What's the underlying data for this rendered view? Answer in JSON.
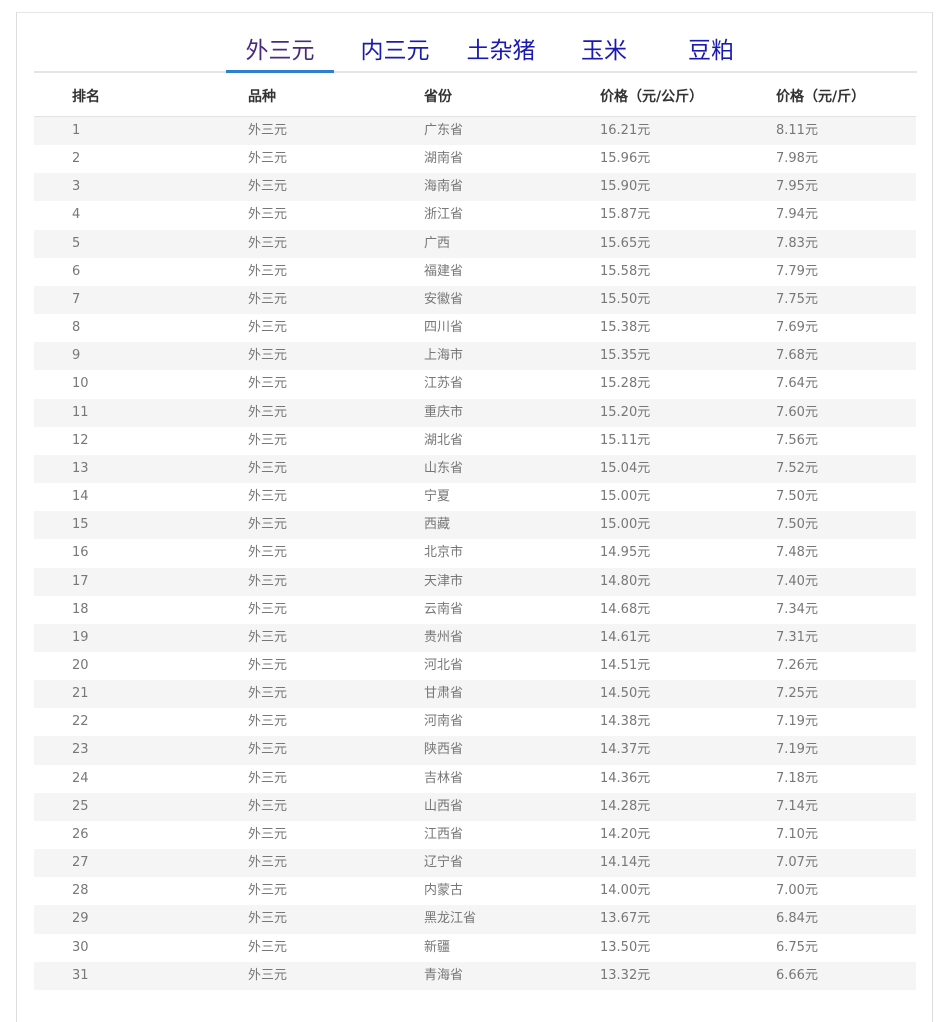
{
  "tabs": [
    {
      "label": "外三元",
      "active": true
    },
    {
      "label": "内三元",
      "active": false
    },
    {
      "label": "土杂猪",
      "active": false
    },
    {
      "label": "玉米",
      "active": false
    },
    {
      "label": "豆粕",
      "active": false
    }
  ],
  "table": {
    "headers": {
      "rank": "排名",
      "breed": "品种",
      "province": "省份",
      "price_kg": "价格（元/公斤）",
      "price_jin": "价格（元/斤）"
    },
    "rows": [
      {
        "rank": "1",
        "breed": "外三元",
        "province": "广东省",
        "price_kg": "16.21元",
        "price_jin": "8.11元"
      },
      {
        "rank": "2",
        "breed": "外三元",
        "province": "湖南省",
        "price_kg": "15.96元",
        "price_jin": "7.98元"
      },
      {
        "rank": "3",
        "breed": "外三元",
        "province": "海南省",
        "price_kg": "15.90元",
        "price_jin": "7.95元"
      },
      {
        "rank": "4",
        "breed": "外三元",
        "province": "浙江省",
        "price_kg": "15.87元",
        "price_jin": "7.94元"
      },
      {
        "rank": "5",
        "breed": "外三元",
        "province": "广西",
        "price_kg": "15.65元",
        "price_jin": "7.83元"
      },
      {
        "rank": "6",
        "breed": "外三元",
        "province": "福建省",
        "price_kg": "15.58元",
        "price_jin": "7.79元"
      },
      {
        "rank": "7",
        "breed": "外三元",
        "province": "安徽省",
        "price_kg": "15.50元",
        "price_jin": "7.75元"
      },
      {
        "rank": "8",
        "breed": "外三元",
        "province": "四川省",
        "price_kg": "15.38元",
        "price_jin": "7.69元"
      },
      {
        "rank": "9",
        "breed": "外三元",
        "province": "上海市",
        "price_kg": "15.35元",
        "price_jin": "7.68元"
      },
      {
        "rank": "10",
        "breed": "外三元",
        "province": "江苏省",
        "price_kg": "15.28元",
        "price_jin": "7.64元"
      },
      {
        "rank": "11",
        "breed": "外三元",
        "province": "重庆市",
        "price_kg": "15.20元",
        "price_jin": "7.60元"
      },
      {
        "rank": "12",
        "breed": "外三元",
        "province": "湖北省",
        "price_kg": "15.11元",
        "price_jin": "7.56元"
      },
      {
        "rank": "13",
        "breed": "外三元",
        "province": "山东省",
        "price_kg": "15.04元",
        "price_jin": "7.52元"
      },
      {
        "rank": "14",
        "breed": "外三元",
        "province": "宁夏",
        "price_kg": "15.00元",
        "price_jin": "7.50元"
      },
      {
        "rank": "15",
        "breed": "外三元",
        "province": "西藏",
        "price_kg": "15.00元",
        "price_jin": "7.50元"
      },
      {
        "rank": "16",
        "breed": "外三元",
        "province": "北京市",
        "price_kg": "14.95元",
        "price_jin": "7.48元"
      },
      {
        "rank": "17",
        "breed": "外三元",
        "province": "天津市",
        "price_kg": "14.80元",
        "price_jin": "7.40元"
      },
      {
        "rank": "18",
        "breed": "外三元",
        "province": "云南省",
        "price_kg": "14.68元",
        "price_jin": "7.34元"
      },
      {
        "rank": "19",
        "breed": "外三元",
        "province": "贵州省",
        "price_kg": "14.61元",
        "price_jin": "7.31元"
      },
      {
        "rank": "20",
        "breed": "外三元",
        "province": "河北省",
        "price_kg": "14.51元",
        "price_jin": "7.26元"
      },
      {
        "rank": "21",
        "breed": "外三元",
        "province": "甘肃省",
        "price_kg": "14.50元",
        "price_jin": "7.25元"
      },
      {
        "rank": "22",
        "breed": "外三元",
        "province": "河南省",
        "price_kg": "14.38元",
        "price_jin": "7.19元"
      },
      {
        "rank": "23",
        "breed": "外三元",
        "province": "陕西省",
        "price_kg": "14.37元",
        "price_jin": "7.19元"
      },
      {
        "rank": "24",
        "breed": "外三元",
        "province": "吉林省",
        "price_kg": "14.36元",
        "price_jin": "7.18元"
      },
      {
        "rank": "25",
        "breed": "外三元",
        "province": "山西省",
        "price_kg": "14.28元",
        "price_jin": "7.14元"
      },
      {
        "rank": "26",
        "breed": "外三元",
        "province": "江西省",
        "price_kg": "14.20元",
        "price_jin": "7.10元"
      },
      {
        "rank": "27",
        "breed": "外三元",
        "province": "辽宁省",
        "price_kg": "14.14元",
        "price_jin": "7.07元"
      },
      {
        "rank": "28",
        "breed": "外三元",
        "province": "内蒙古",
        "price_kg": "14.00元",
        "price_jin": "7.00元"
      },
      {
        "rank": "29",
        "breed": "外三元",
        "province": "黑龙江省",
        "price_kg": "13.67元",
        "price_jin": "6.84元"
      },
      {
        "rank": "30",
        "breed": "外三元",
        "province": "新疆",
        "price_kg": "13.50元",
        "price_jin": "6.75元"
      },
      {
        "rank": "31",
        "breed": "外三元",
        "province": "青海省",
        "price_kg": "13.32元",
        "price_jin": "6.66元"
      }
    ]
  }
}
